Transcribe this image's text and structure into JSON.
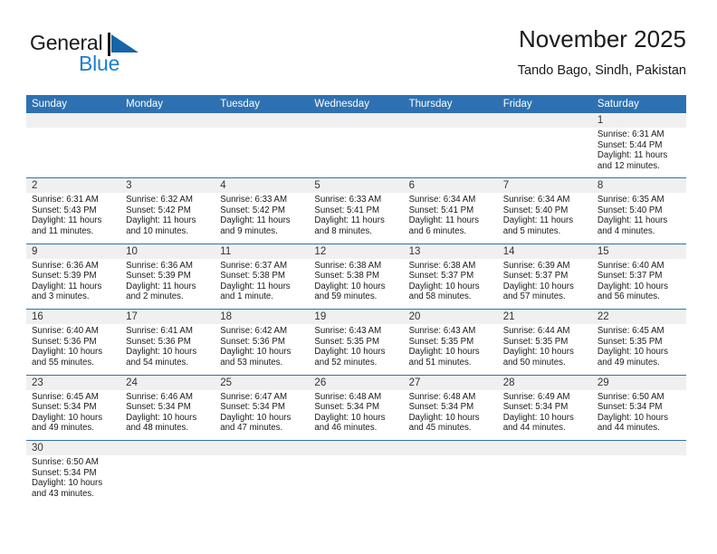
{
  "brand": {
    "name_part1": "General",
    "name_part2": "Blue",
    "flag_color": "#1565a8",
    "blue_text_color": "#1c7fd0"
  },
  "header": {
    "title": "November 2025",
    "location": "Tando Bago, Sindh, Pakistan"
  },
  "theme": {
    "header_blue": "#2e71b2",
    "day_band_gray": "#f0f0f0",
    "grid_line": "#2e71b2"
  },
  "weekdays": [
    "Sunday",
    "Monday",
    "Tuesday",
    "Wednesday",
    "Thursday",
    "Friday",
    "Saturday"
  ],
  "weeks": [
    [
      {
        "day": "",
        "empty": true
      },
      {
        "day": "",
        "empty": true
      },
      {
        "day": "",
        "empty": true
      },
      {
        "day": "",
        "empty": true
      },
      {
        "day": "",
        "empty": true
      },
      {
        "day": "",
        "empty": true
      },
      {
        "day": "1",
        "sunrise": "Sunrise: 6:31 AM",
        "sunset": "Sunset: 5:44 PM",
        "daylight_line1": "Daylight: 11 hours",
        "daylight_line2": "and 12 minutes."
      }
    ],
    [
      {
        "day": "2",
        "sunrise": "Sunrise: 6:31 AM",
        "sunset": "Sunset: 5:43 PM",
        "daylight_line1": "Daylight: 11 hours",
        "daylight_line2": "and 11 minutes."
      },
      {
        "day": "3",
        "sunrise": "Sunrise: 6:32 AM",
        "sunset": "Sunset: 5:42 PM",
        "daylight_line1": "Daylight: 11 hours",
        "daylight_line2": "and 10 minutes."
      },
      {
        "day": "4",
        "sunrise": "Sunrise: 6:33 AM",
        "sunset": "Sunset: 5:42 PM",
        "daylight_line1": "Daylight: 11 hours",
        "daylight_line2": "and 9 minutes."
      },
      {
        "day": "5",
        "sunrise": "Sunrise: 6:33 AM",
        "sunset": "Sunset: 5:41 PM",
        "daylight_line1": "Daylight: 11 hours",
        "daylight_line2": "and 8 minutes."
      },
      {
        "day": "6",
        "sunrise": "Sunrise: 6:34 AM",
        "sunset": "Sunset: 5:41 PM",
        "daylight_line1": "Daylight: 11 hours",
        "daylight_line2": "and 6 minutes."
      },
      {
        "day": "7",
        "sunrise": "Sunrise: 6:34 AM",
        "sunset": "Sunset: 5:40 PM",
        "daylight_line1": "Daylight: 11 hours",
        "daylight_line2": "and 5 minutes."
      },
      {
        "day": "8",
        "sunrise": "Sunrise: 6:35 AM",
        "sunset": "Sunset: 5:40 PM",
        "daylight_line1": "Daylight: 11 hours",
        "daylight_line2": "and 4 minutes."
      }
    ],
    [
      {
        "day": "9",
        "sunrise": "Sunrise: 6:36 AM",
        "sunset": "Sunset: 5:39 PM",
        "daylight_line1": "Daylight: 11 hours",
        "daylight_line2": "and 3 minutes."
      },
      {
        "day": "10",
        "sunrise": "Sunrise: 6:36 AM",
        "sunset": "Sunset: 5:39 PM",
        "daylight_line1": "Daylight: 11 hours",
        "daylight_line2": "and 2 minutes."
      },
      {
        "day": "11",
        "sunrise": "Sunrise: 6:37 AM",
        "sunset": "Sunset: 5:38 PM",
        "daylight_line1": "Daylight: 11 hours",
        "daylight_line2": "and 1 minute."
      },
      {
        "day": "12",
        "sunrise": "Sunrise: 6:38 AM",
        "sunset": "Sunset: 5:38 PM",
        "daylight_line1": "Daylight: 10 hours",
        "daylight_line2": "and 59 minutes."
      },
      {
        "day": "13",
        "sunrise": "Sunrise: 6:38 AM",
        "sunset": "Sunset: 5:37 PM",
        "daylight_line1": "Daylight: 10 hours",
        "daylight_line2": "and 58 minutes."
      },
      {
        "day": "14",
        "sunrise": "Sunrise: 6:39 AM",
        "sunset": "Sunset: 5:37 PM",
        "daylight_line1": "Daylight: 10 hours",
        "daylight_line2": "and 57 minutes."
      },
      {
        "day": "15",
        "sunrise": "Sunrise: 6:40 AM",
        "sunset": "Sunset: 5:37 PM",
        "daylight_line1": "Daylight: 10 hours",
        "daylight_line2": "and 56 minutes."
      }
    ],
    [
      {
        "day": "16",
        "sunrise": "Sunrise: 6:40 AM",
        "sunset": "Sunset: 5:36 PM",
        "daylight_line1": "Daylight: 10 hours",
        "daylight_line2": "and 55 minutes."
      },
      {
        "day": "17",
        "sunrise": "Sunrise: 6:41 AM",
        "sunset": "Sunset: 5:36 PM",
        "daylight_line1": "Daylight: 10 hours",
        "daylight_line2": "and 54 minutes."
      },
      {
        "day": "18",
        "sunrise": "Sunrise: 6:42 AM",
        "sunset": "Sunset: 5:36 PM",
        "daylight_line1": "Daylight: 10 hours",
        "daylight_line2": "and 53 minutes."
      },
      {
        "day": "19",
        "sunrise": "Sunrise: 6:43 AM",
        "sunset": "Sunset: 5:35 PM",
        "daylight_line1": "Daylight: 10 hours",
        "daylight_line2": "and 52 minutes."
      },
      {
        "day": "20",
        "sunrise": "Sunrise: 6:43 AM",
        "sunset": "Sunset: 5:35 PM",
        "daylight_line1": "Daylight: 10 hours",
        "daylight_line2": "and 51 minutes."
      },
      {
        "day": "21",
        "sunrise": "Sunrise: 6:44 AM",
        "sunset": "Sunset: 5:35 PM",
        "daylight_line1": "Daylight: 10 hours",
        "daylight_line2": "and 50 minutes."
      },
      {
        "day": "22",
        "sunrise": "Sunrise: 6:45 AM",
        "sunset": "Sunset: 5:35 PM",
        "daylight_line1": "Daylight: 10 hours",
        "daylight_line2": "and 49 minutes."
      }
    ],
    [
      {
        "day": "23",
        "sunrise": "Sunrise: 6:45 AM",
        "sunset": "Sunset: 5:34 PM",
        "daylight_line1": "Daylight: 10 hours",
        "daylight_line2": "and 49 minutes."
      },
      {
        "day": "24",
        "sunrise": "Sunrise: 6:46 AM",
        "sunset": "Sunset: 5:34 PM",
        "daylight_line1": "Daylight: 10 hours",
        "daylight_line2": "and 48 minutes."
      },
      {
        "day": "25",
        "sunrise": "Sunrise: 6:47 AM",
        "sunset": "Sunset: 5:34 PM",
        "daylight_line1": "Daylight: 10 hours",
        "daylight_line2": "and 47 minutes."
      },
      {
        "day": "26",
        "sunrise": "Sunrise: 6:48 AM",
        "sunset": "Sunset: 5:34 PM",
        "daylight_line1": "Daylight: 10 hours",
        "daylight_line2": "and 46 minutes."
      },
      {
        "day": "27",
        "sunrise": "Sunrise: 6:48 AM",
        "sunset": "Sunset: 5:34 PM",
        "daylight_line1": "Daylight: 10 hours",
        "daylight_line2": "and 45 minutes."
      },
      {
        "day": "28",
        "sunrise": "Sunrise: 6:49 AM",
        "sunset": "Sunset: 5:34 PM",
        "daylight_line1": "Daylight: 10 hours",
        "daylight_line2": "and 44 minutes."
      },
      {
        "day": "29",
        "sunrise": "Sunrise: 6:50 AM",
        "sunset": "Sunset: 5:34 PM",
        "daylight_line1": "Daylight: 10 hours",
        "daylight_line2": "and 44 minutes."
      }
    ],
    [
      {
        "day": "30",
        "sunrise": "Sunrise: 6:50 AM",
        "sunset": "Sunset: 5:34 PM",
        "daylight_line1": "Daylight: 10 hours",
        "daylight_line2": "and 43 minutes."
      },
      {
        "day": "",
        "empty": true
      },
      {
        "day": "",
        "empty": true
      },
      {
        "day": "",
        "empty": true
      },
      {
        "day": "",
        "empty": true
      },
      {
        "day": "",
        "empty": true
      },
      {
        "day": "",
        "empty": true
      }
    ]
  ]
}
